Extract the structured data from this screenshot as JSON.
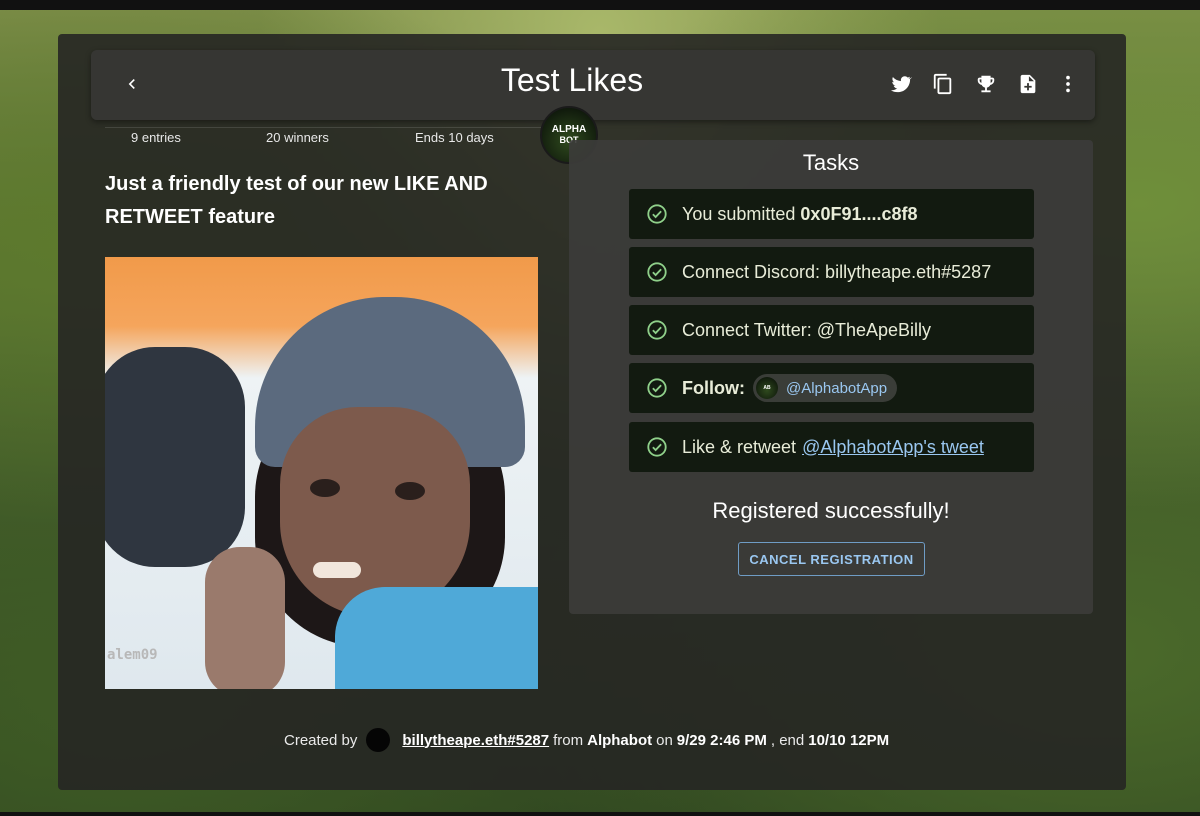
{
  "header": {
    "title": "Test Likes",
    "back_icon": "chevron-left-icon",
    "actions": [
      "twitter-icon",
      "copy-icon",
      "trophy-icon",
      "add-file-icon",
      "more-vert-icon"
    ]
  },
  "stats": {
    "entries": "9 entries",
    "winners": "20 winners",
    "ends": "Ends 10 days"
  },
  "logo": {
    "line1": "ALPHA",
    "line2": "BOT"
  },
  "description": "Just a friendly test of our new LIKE AND RETWEET feature",
  "image": {
    "watermark": "alem09"
  },
  "tasks": {
    "title": "Tasks",
    "submitted_label": "You submitted",
    "submitted_value": "0x0F91....c8f8",
    "discord": "Connect Discord: billytheape.eth#5287",
    "twitter": "Connect Twitter: @TheApeBilly",
    "follow_label": "Follow:",
    "follow_handle": "@AlphabotApp",
    "like_label": "Like & retweet",
    "like_link": "@AlphabotApp's tweet"
  },
  "status": {
    "registered": "Registered successfully!",
    "cancel_button": "CANCEL REGISTRATION"
  },
  "footer": {
    "created_by": "Created by",
    "creator": "billytheape.eth#5287",
    "from": "from",
    "platform": "Alphabot",
    "on": "on",
    "start": "9/29 2:46 PM",
    "end_label": ", end",
    "end": "10/10 12PM"
  },
  "colors": {
    "accent_link": "#9ac7f0",
    "check_green": "#8fd08a",
    "task_bg": "#121a10"
  }
}
